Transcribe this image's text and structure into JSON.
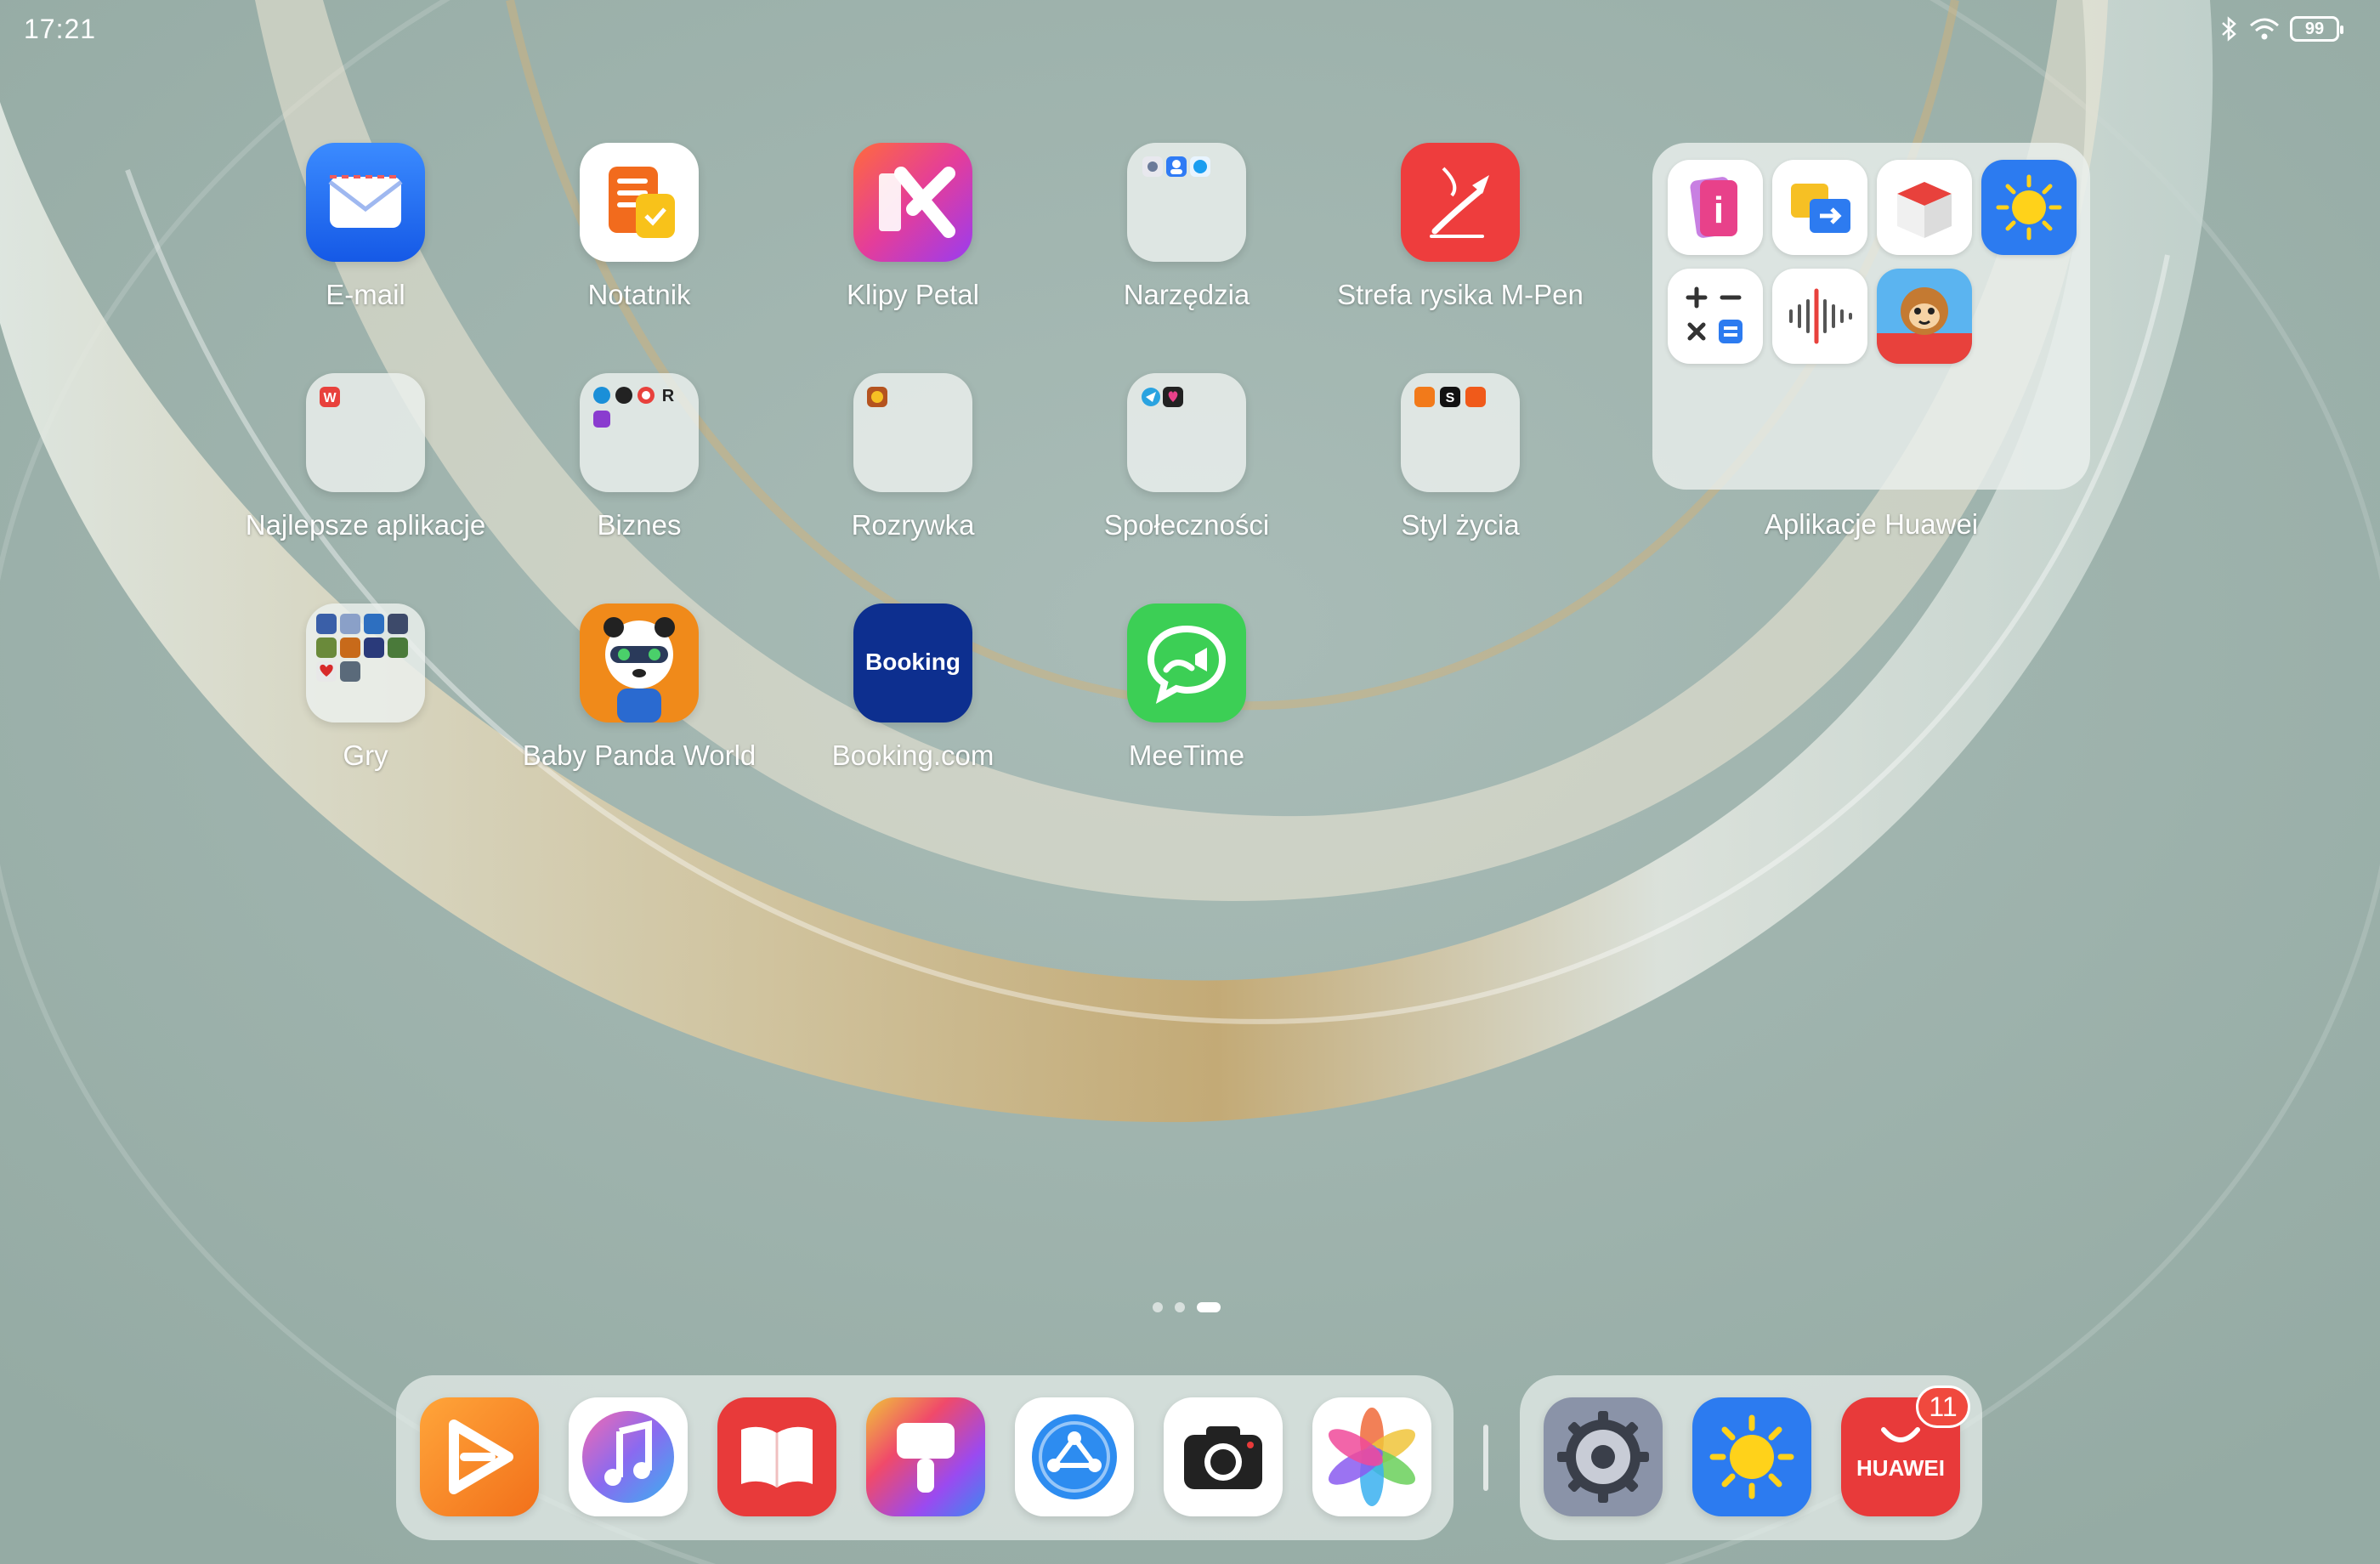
{
  "status_bar": {
    "time": "17:21",
    "battery": "99",
    "icons": [
      "bluetooth-icon",
      "wifi-icon",
      "battery-icon"
    ]
  },
  "apps": {
    "email": "E-mail",
    "notatnik": "Notatnik",
    "klipy": "Klipy Petal",
    "narzedzia": "Narzędzia",
    "strefa": "Strefa rysika M-Pen",
    "najlepsze": "Najlepsze aplikacje",
    "biznes": "Biznes",
    "rozrywka": "Rozrywka",
    "spolecznosci": "Społeczności",
    "styl": "Styl życia",
    "gry": "Gry",
    "baby_panda": "Baby Panda World",
    "booking": "Booking.com",
    "meetime": "MeeTime"
  },
  "huawei_folder": {
    "label": "Aplikacje Huawei"
  },
  "booking_icon_text": "Booking",
  "huawei_store_icon_text": "HUAWEI",
  "dock": {
    "badge": "11"
  },
  "pages": {
    "count": 3,
    "active": 3
  },
  "colors": {
    "accent_red": "#f0493e",
    "email_blue": "#1f6cf2",
    "meetime_green": "#3ccf55",
    "booking_navy": "#0d2f8f"
  }
}
